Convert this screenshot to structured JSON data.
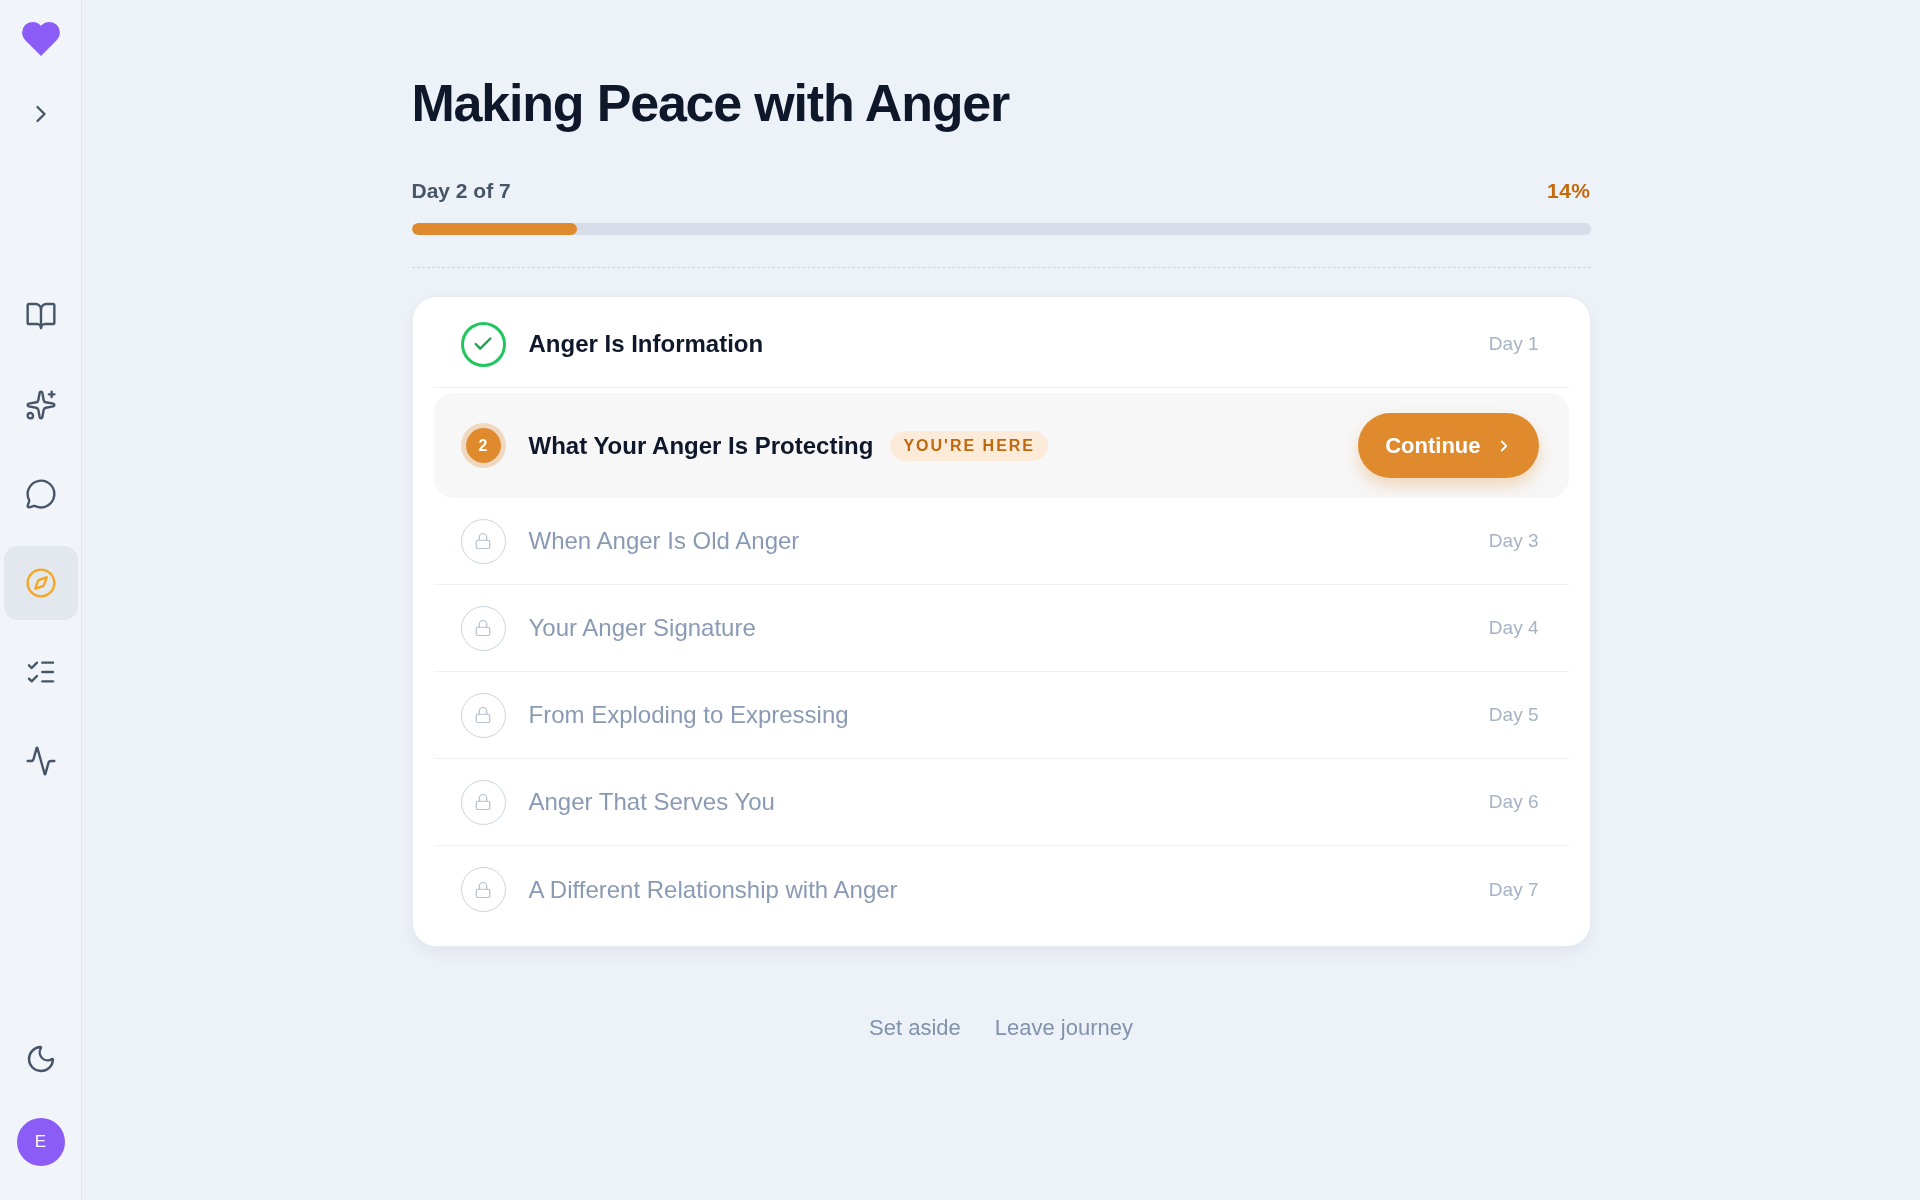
{
  "sidebar": {
    "nav_items": [
      {
        "kind": "book",
        "selected": false
      },
      {
        "kind": "sparkles",
        "selected": false
      },
      {
        "kind": "chat",
        "selected": false
      },
      {
        "kind": "compass",
        "selected": true
      },
      {
        "kind": "checklist",
        "selected": false
      },
      {
        "kind": "activity",
        "selected": false
      }
    ],
    "avatar": {
      "initial": "E"
    }
  },
  "journey": {
    "title": "Making Peace with Anger",
    "progress": {
      "label": "Day 2 of 7",
      "percent": "14%",
      "level": 0.14
    },
    "lessons": [
      {
        "kind": "done",
        "title": "Anger Is Information",
        "day": "Day 1"
      },
      {
        "kind": "current",
        "step": "2",
        "title": "What Your Anger Is Protecting",
        "badge": "YOU'RE HERE",
        "button": "Continue"
      },
      {
        "kind": "locked",
        "title": "When Anger Is Old Anger",
        "day": "Day 3"
      },
      {
        "kind": "locked",
        "title": "Your Anger Signature",
        "day": "Day 4"
      },
      {
        "kind": "locked",
        "title": "From Exploding to Expressing",
        "day": "Day 5"
      },
      {
        "kind": "locked",
        "title": "Anger That Serves You",
        "day": "Day 6"
      },
      {
        "kind": "locked",
        "title": "A Different Relationship with Anger",
        "day": "Day 7"
      }
    ]
  },
  "footer_links": [
    "Set aside",
    "Leave journey"
  ]
}
